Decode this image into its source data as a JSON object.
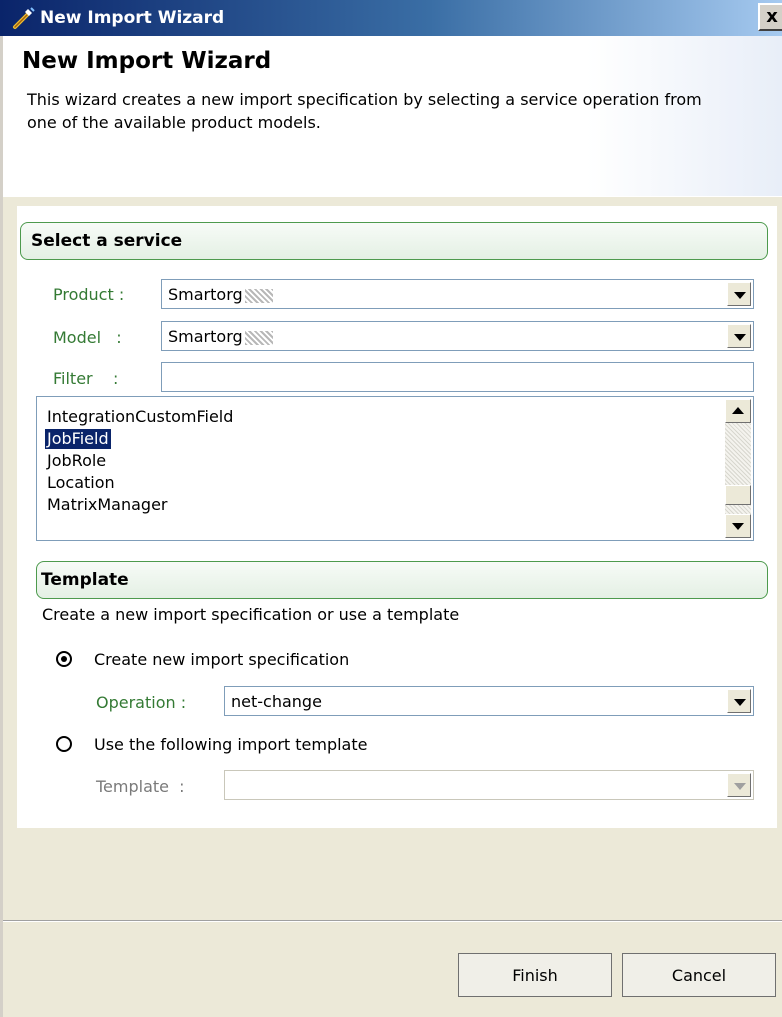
{
  "window": {
    "title": "New Import Wizard",
    "close_label": "x"
  },
  "header": {
    "title": "New Import Wizard",
    "description": "This wizard creates a new import specification by selecting a service operation from one of the available product models."
  },
  "select_service": {
    "title": "Select a service",
    "product": {
      "label": "Product :",
      "value": "Smartorg"
    },
    "model": {
      "label": "Model   :",
      "value": "Smartorg"
    },
    "filter": {
      "label": "Filter    :",
      "value": ""
    },
    "services": [
      "IntegrationCustomField",
      "JobField",
      "JobRole",
      "Location",
      "MatrixManager"
    ],
    "selected_service": "JobField"
  },
  "template_section": {
    "title": "Template",
    "description": "Create a new import specification or use a template",
    "option_new": "Create new import specification",
    "operation": {
      "label": "Operation :",
      "value": "net-change"
    },
    "option_template": "Use the following import template",
    "template": {
      "label": "Template  :",
      "value": ""
    },
    "selected_option": "new"
  },
  "buttons": {
    "finish": "Finish",
    "cancel": "Cancel"
  },
  "colors": {
    "title_gradient_start": "#0a246a",
    "label_green": "#347a34",
    "selection": "#0a246a"
  }
}
